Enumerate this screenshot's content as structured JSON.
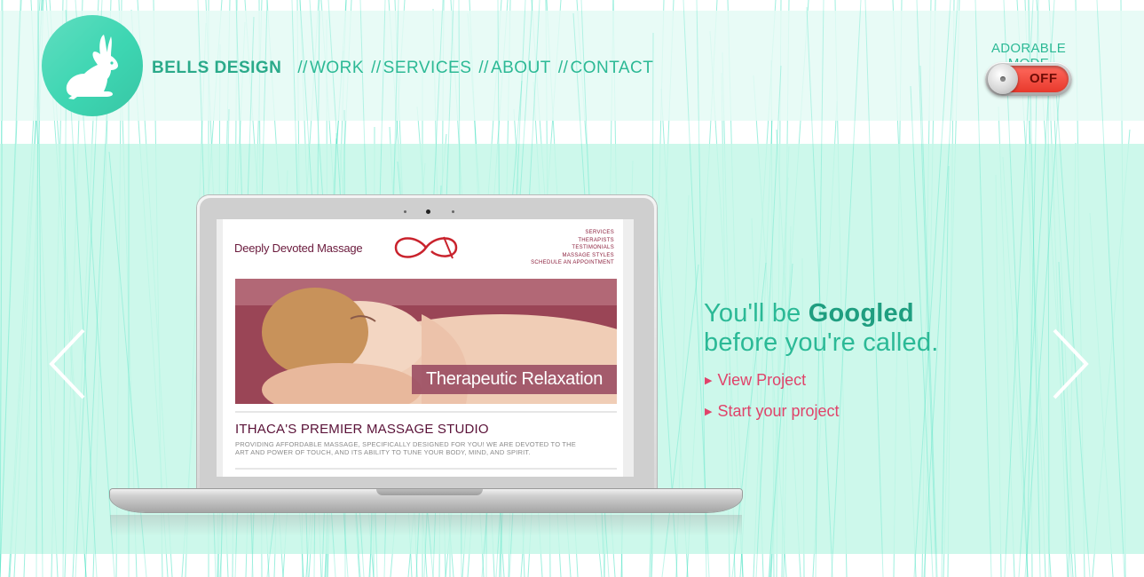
{
  "header": {
    "brand": "BELLS DESIGN",
    "separator": "//",
    "nav": [
      {
        "label": "WORK"
      },
      {
        "label": "SERVICES"
      },
      {
        "label": "ABOUT"
      },
      {
        "label": "CONTACT"
      }
    ],
    "logo_icon": "rabbit-icon"
  },
  "adorable_mode": {
    "label": "ADORABLE MODE",
    "state": "OFF"
  },
  "hero": {
    "tagline_line1_prefix": "You'll be ",
    "tagline_emphasis": "Googled",
    "tagline_line2": "before you're called.",
    "actions": [
      {
        "label": "View Project",
        "icon": "triangle-right-icon"
      },
      {
        "label": "Start your project",
        "icon": "triangle-right-icon"
      }
    ],
    "prev_icon": "chevron-left-icon",
    "next_icon": "chevron-right-icon"
  },
  "laptop_screen": {
    "site_title": "Deeply Devoted Massage",
    "site_logo_icon": "infinity-logo-icon",
    "menu": [
      "SERVICES",
      "THERAPISTS",
      "TESTIMONIALS",
      "MASSAGE STYLES",
      "SCHEDULE AN APPOINTMENT"
    ],
    "hero_caption": "Therapeutic Relaxation",
    "heading": "ITHACA'S PREMIER MASSAGE STUDIO",
    "body": "PROVIDING AFFORDABLE MASSAGE, SPECIFICALLY DESIGNED FOR YOU! WE ARE DEVOTED TO THE ART AND POWER OF TOUCH, AND ITS ABILITY TO TUNE YOUR BODY, MIND, AND SPIRIT."
  },
  "colors": {
    "accent": "#2cb995",
    "logo": "#3dd6b2",
    "hero_band": "#c4f7e8",
    "cta": "#e0436a",
    "toggle_off": "#e8392c"
  }
}
